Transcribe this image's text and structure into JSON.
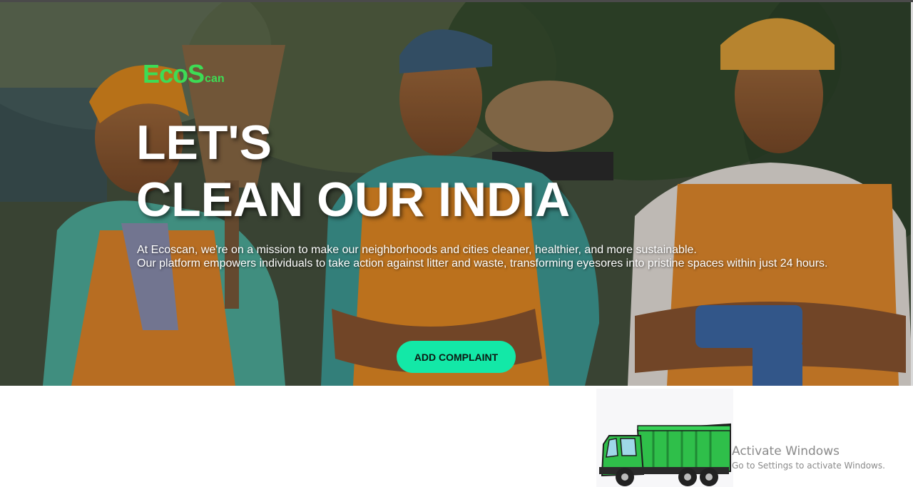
{
  "logo": {
    "big_text": "EcoS",
    "small_text": "can"
  },
  "hero": {
    "headline_line1": "LET'S",
    "headline_line2": "CLEAN OUR INDIA",
    "description_line1": "At Ecoscan, we're on a mission to make our neighborhoods and cities cleaner, healthier, and more sustainable.",
    "description_line2": "Our platform empowers individuals to take action against litter and waste, transforming eyesores into pristine spaces within just 24 hours.",
    "cta_label": "ADD COMPLAINT"
  },
  "illustration": {
    "subject": "green-garbage-truck"
  },
  "os_overlay": {
    "title": "Activate Windows",
    "subtitle": "Go to Settings to activate Windows."
  },
  "colors": {
    "logo_green": "#3ddc55",
    "cta_background": "#13e8a7",
    "truck_green": "#2fbf4a"
  }
}
